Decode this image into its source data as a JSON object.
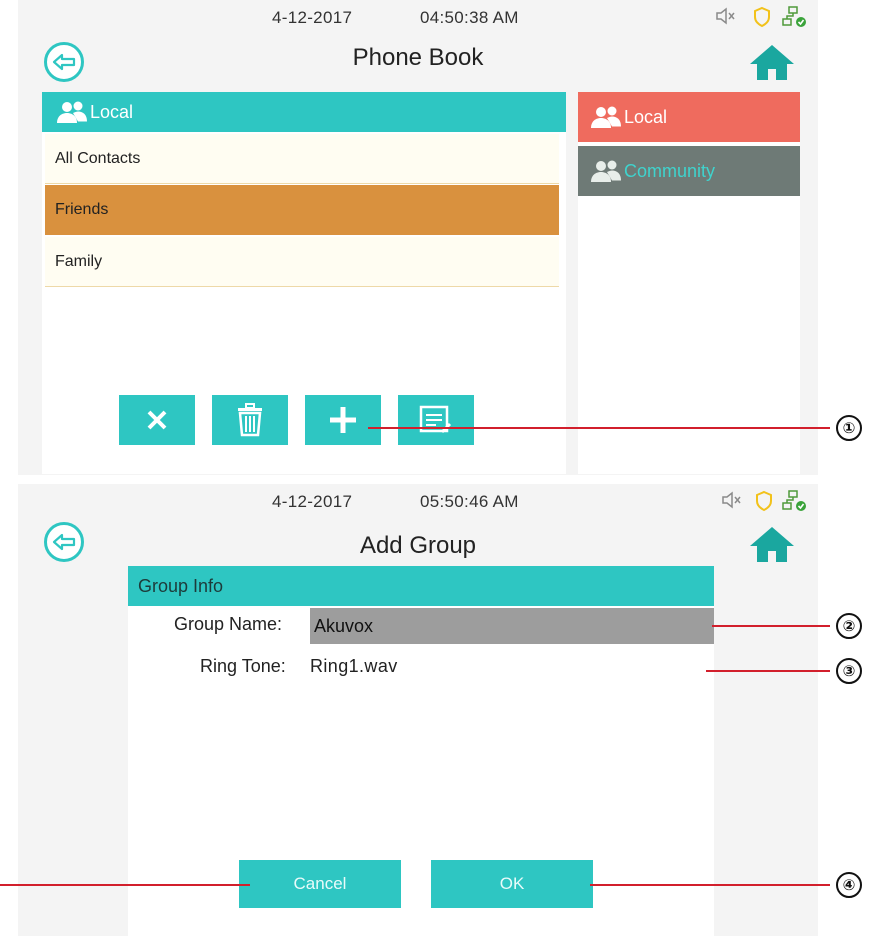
{
  "colors": {
    "accent": "#2ec6c2",
    "selected": "#d9913e",
    "local_tab": "#ef6b5e",
    "community_tab": "#6e7a76",
    "callout": "#d21f2c"
  },
  "phonebook": {
    "date": "4-12-2017",
    "time": "04:50:38  AM",
    "title": "Phone Book",
    "status_icons": [
      "mute-icon",
      "shield-icon",
      "network-icon"
    ],
    "section_header": "Local",
    "groups": [
      {
        "label": "All Contacts",
        "selected": false
      },
      {
        "label": "Friends",
        "selected": true
      },
      {
        "label": "Family",
        "selected": false
      }
    ],
    "side_tabs": [
      {
        "label": "Local",
        "active": true
      },
      {
        "label": "Community",
        "active": false
      }
    ],
    "toolbar": [
      "close-icon",
      "trash-icon",
      "plus-icon",
      "edit-icon"
    ]
  },
  "add_group": {
    "date": "4-12-2017",
    "time": "05:50:46  AM",
    "title": "Add Group",
    "section_header": "Group Info",
    "group_name_label": "Group Name:",
    "group_name_value": "Akuvox",
    "ring_tone_label": "Ring Tone:",
    "ring_tone_value": "Ring1.wav",
    "cancel_label": "Cancel",
    "ok_label": "OK"
  },
  "callouts": [
    "①",
    "②",
    "③",
    "④"
  ]
}
